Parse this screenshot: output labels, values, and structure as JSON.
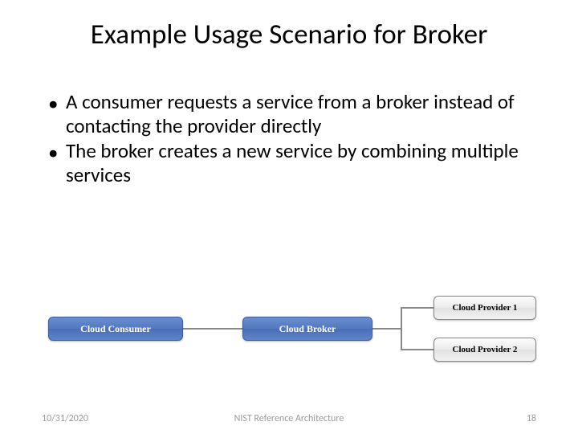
{
  "title": "Example Usage Scenario for Broker",
  "bullets": [
    "A consumer requests a service from a broker instead of contacting the provider directly",
    "The broker creates a new service by combining multiple services"
  ],
  "diagram": {
    "consumer": "Cloud Consumer",
    "broker": "Cloud Broker",
    "provider1": "Cloud Provider 1",
    "provider2": "Cloud Provider 2"
  },
  "footer": {
    "date": "10/31/2020",
    "center": "NIST Reference Architecture",
    "page": "18"
  }
}
